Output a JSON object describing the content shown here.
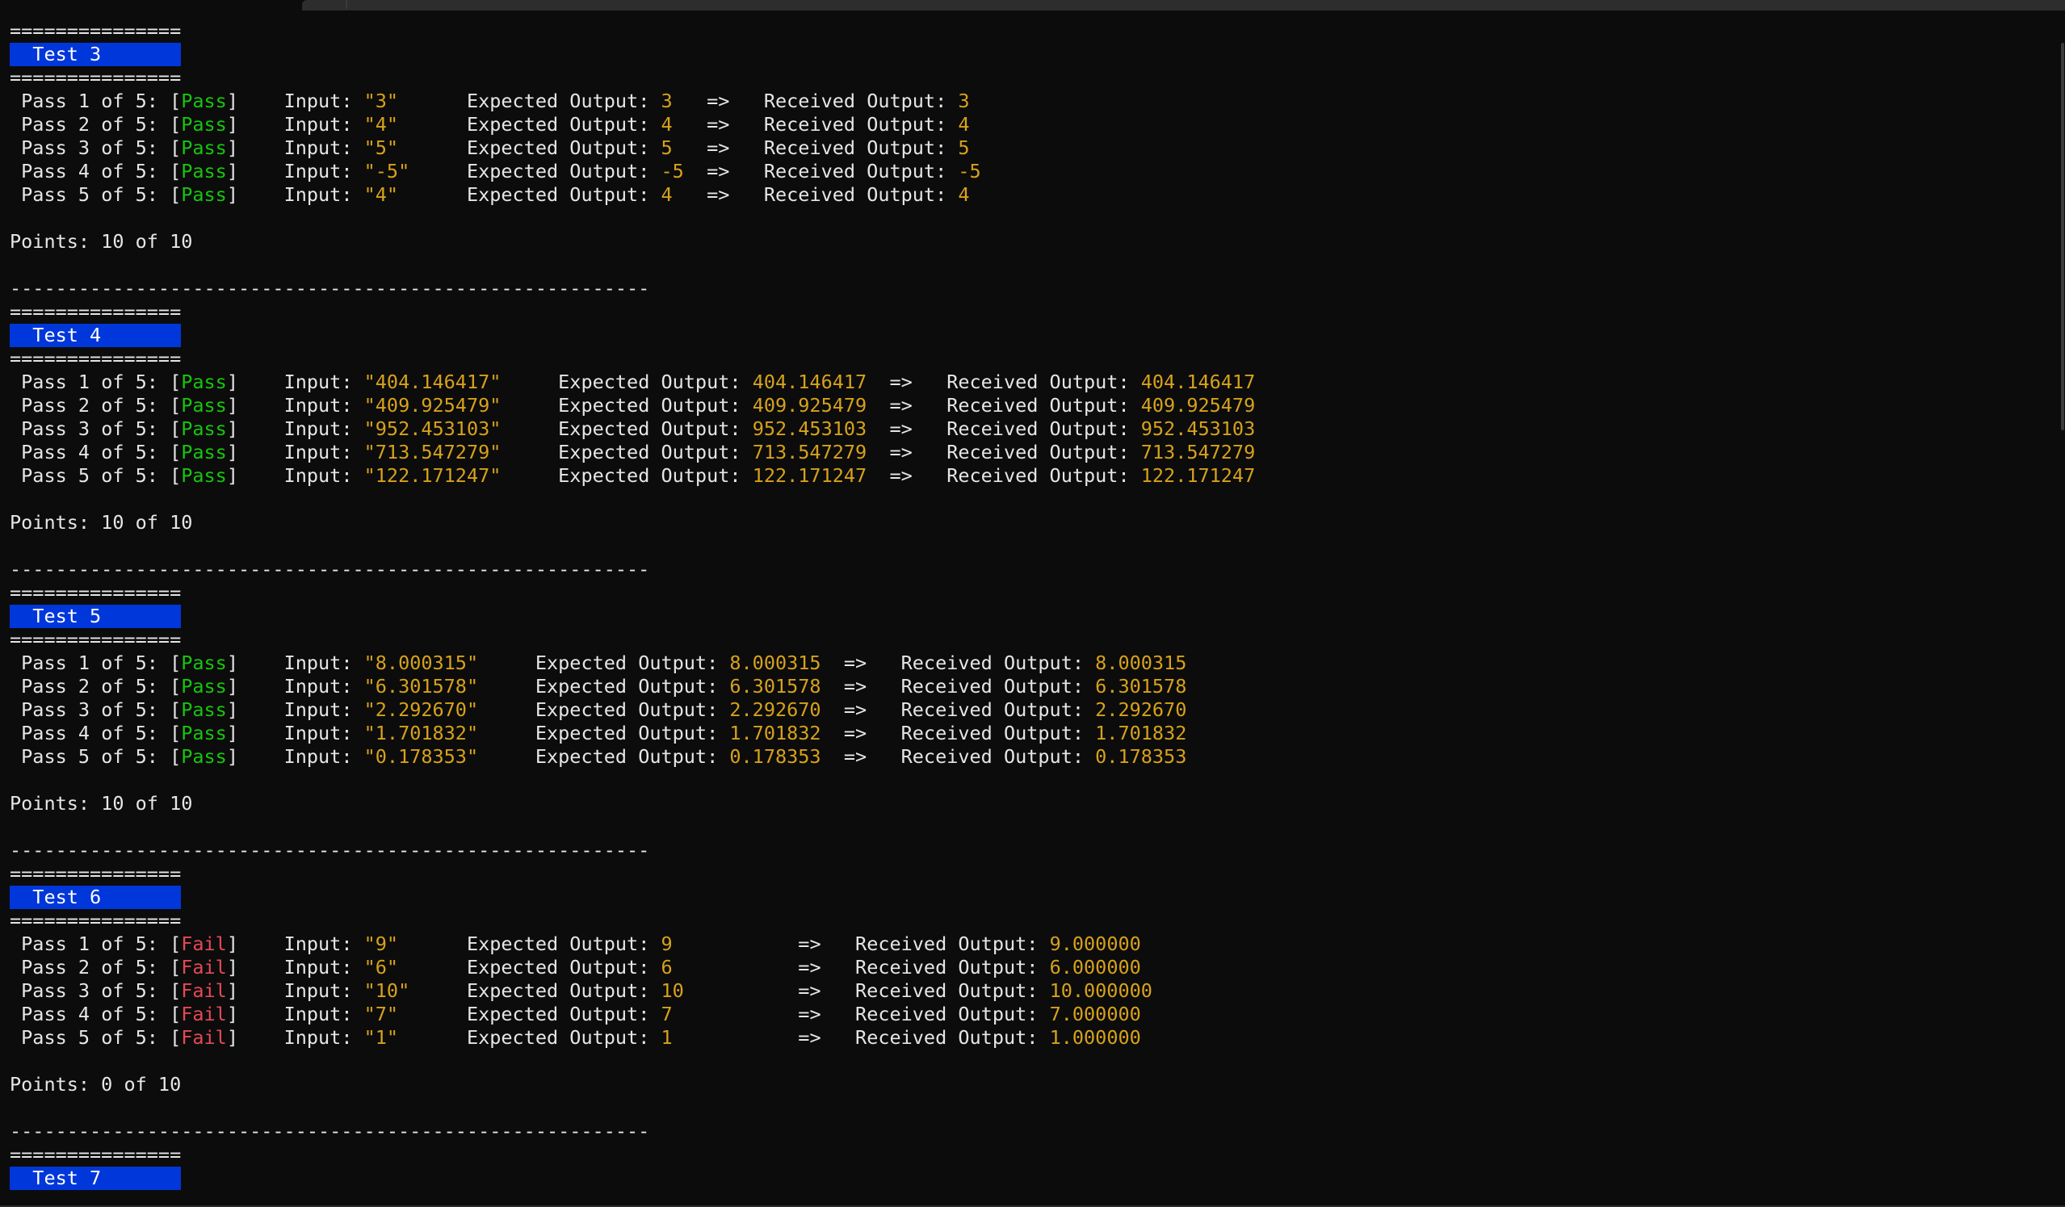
{
  "terminal": {
    "divider_short": "===============",
    "divider_long": "--------------------------------------------------------",
    "pass_label": "Pass",
    "fail_label": "Fail",
    "input_label": "Input:",
    "expected_label": "Expected Output:",
    "arrow": "=>",
    "received_label": "Received Output:",
    "tests": [
      {
        "title": "  Test 3",
        "rows": [
          {
            "label": "Pass 1 of 5:",
            "status": "Pass",
            "input": "\"3\"",
            "expected": "3",
            "received": "3"
          },
          {
            "label": "Pass 2 of 5:",
            "status": "Pass",
            "input": "\"4\"",
            "expected": "4",
            "received": "4"
          },
          {
            "label": "Pass 3 of 5:",
            "status": "Pass",
            "input": "\"5\"",
            "expected": "5",
            "received": "5"
          },
          {
            "label": "Pass 4 of 5:",
            "status": "Pass",
            "input": "\"-5\"",
            "expected": "-5",
            "received": "-5"
          },
          {
            "label": "Pass 5 of 5:",
            "status": "Pass",
            "input": "\"4\"",
            "expected": "4",
            "received": "4"
          }
        ],
        "points": "Points: 10 of 10"
      },
      {
        "title": "  Test 4",
        "rows": [
          {
            "label": "Pass 1 of 5:",
            "status": "Pass",
            "input": "\"404.146417\"",
            "expected": "404.146417",
            "received": "404.146417"
          },
          {
            "label": "Pass 2 of 5:",
            "status": "Pass",
            "input": "\"409.925479\"",
            "expected": "409.925479",
            "received": "409.925479"
          },
          {
            "label": "Pass 3 of 5:",
            "status": "Pass",
            "input": "\"952.453103\"",
            "expected": "952.453103",
            "received": "952.453103"
          },
          {
            "label": "Pass 4 of 5:",
            "status": "Pass",
            "input": "\"713.547279\"",
            "expected": "713.547279",
            "received": "713.547279"
          },
          {
            "label": "Pass 5 of 5:",
            "status": "Pass",
            "input": "\"122.171247\"",
            "expected": "122.171247",
            "received": "122.171247"
          }
        ],
        "points": "Points: 10 of 10"
      },
      {
        "title": "  Test 5",
        "rows": [
          {
            "label": "Pass 1 of 5:",
            "status": "Pass",
            "input": "\"8.000315\"",
            "expected": "8.000315",
            "received": "8.000315"
          },
          {
            "label": "Pass 2 of 5:",
            "status": "Pass",
            "input": "\"6.301578\"",
            "expected": "6.301578",
            "received": "6.301578"
          },
          {
            "label": "Pass 3 of 5:",
            "status": "Pass",
            "input": "\"2.292670\"",
            "expected": "2.292670",
            "received": "2.292670"
          },
          {
            "label": "Pass 4 of 5:",
            "status": "Pass",
            "input": "\"1.701832\"",
            "expected": "1.701832",
            "received": "1.701832"
          },
          {
            "label": "Pass 5 of 5:",
            "status": "Pass",
            "input": "\"0.178353\"",
            "expected": "0.178353",
            "received": "0.178353"
          }
        ],
        "points": "Points: 10 of 10"
      },
      {
        "title": "  Test 6",
        "rows": [
          {
            "label": "Pass 1 of 5:",
            "status": "Fail",
            "input": "\"9\"",
            "expected": "9",
            "received": "9.000000"
          },
          {
            "label": "Pass 2 of 5:",
            "status": "Fail",
            "input": "\"6\"",
            "expected": "6",
            "received": "6.000000"
          },
          {
            "label": "Pass 3 of 5:",
            "status": "Fail",
            "input": "\"10\"",
            "expected": "10",
            "received": "10.000000"
          },
          {
            "label": "Pass 4 of 5:",
            "status": "Fail",
            "input": "\"7\"",
            "expected": "7",
            "received": "7.000000"
          },
          {
            "label": "Pass 5 of 5:",
            "status": "Fail",
            "input": "\"1\"",
            "expected": "1",
            "received": "1.000000"
          }
        ],
        "points": "Points: 0 of 10"
      },
      {
        "title": "  Test 7",
        "rows": [],
        "points": ""
      }
    ]
  }
}
